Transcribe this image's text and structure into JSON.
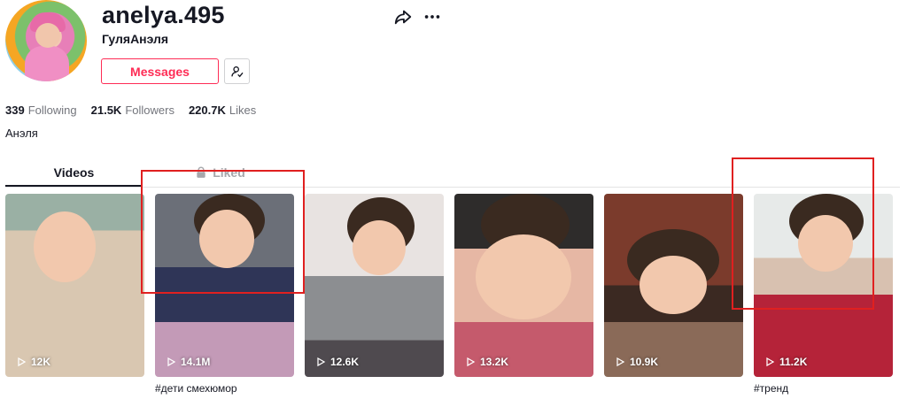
{
  "profile": {
    "username": "anelya.495",
    "nickname": "ГуляАнэля",
    "bio": "Анэля",
    "messages_label": "Messages"
  },
  "stats": [
    {
      "num": "339",
      "label": "Following"
    },
    {
      "num": "21.5K",
      "label": "Followers"
    },
    {
      "num": "220.7K",
      "label": "Likes"
    }
  ],
  "tabs": {
    "videos": "Videos",
    "liked": "Liked"
  },
  "videos": [
    {
      "views": "12K",
      "caption": ""
    },
    {
      "views": "14.1M",
      "caption": "#дети смехюмор"
    },
    {
      "views": "12.6K",
      "caption": ""
    },
    {
      "views": "13.2K",
      "caption": ""
    },
    {
      "views": "10.9K",
      "caption": ""
    },
    {
      "views": "11.2K",
      "caption": "#тренд"
    }
  ],
  "colors": {
    "accent": "#fe2c55",
    "text": "#161823",
    "muted": "#73757c",
    "annotation": "#e02020"
  }
}
